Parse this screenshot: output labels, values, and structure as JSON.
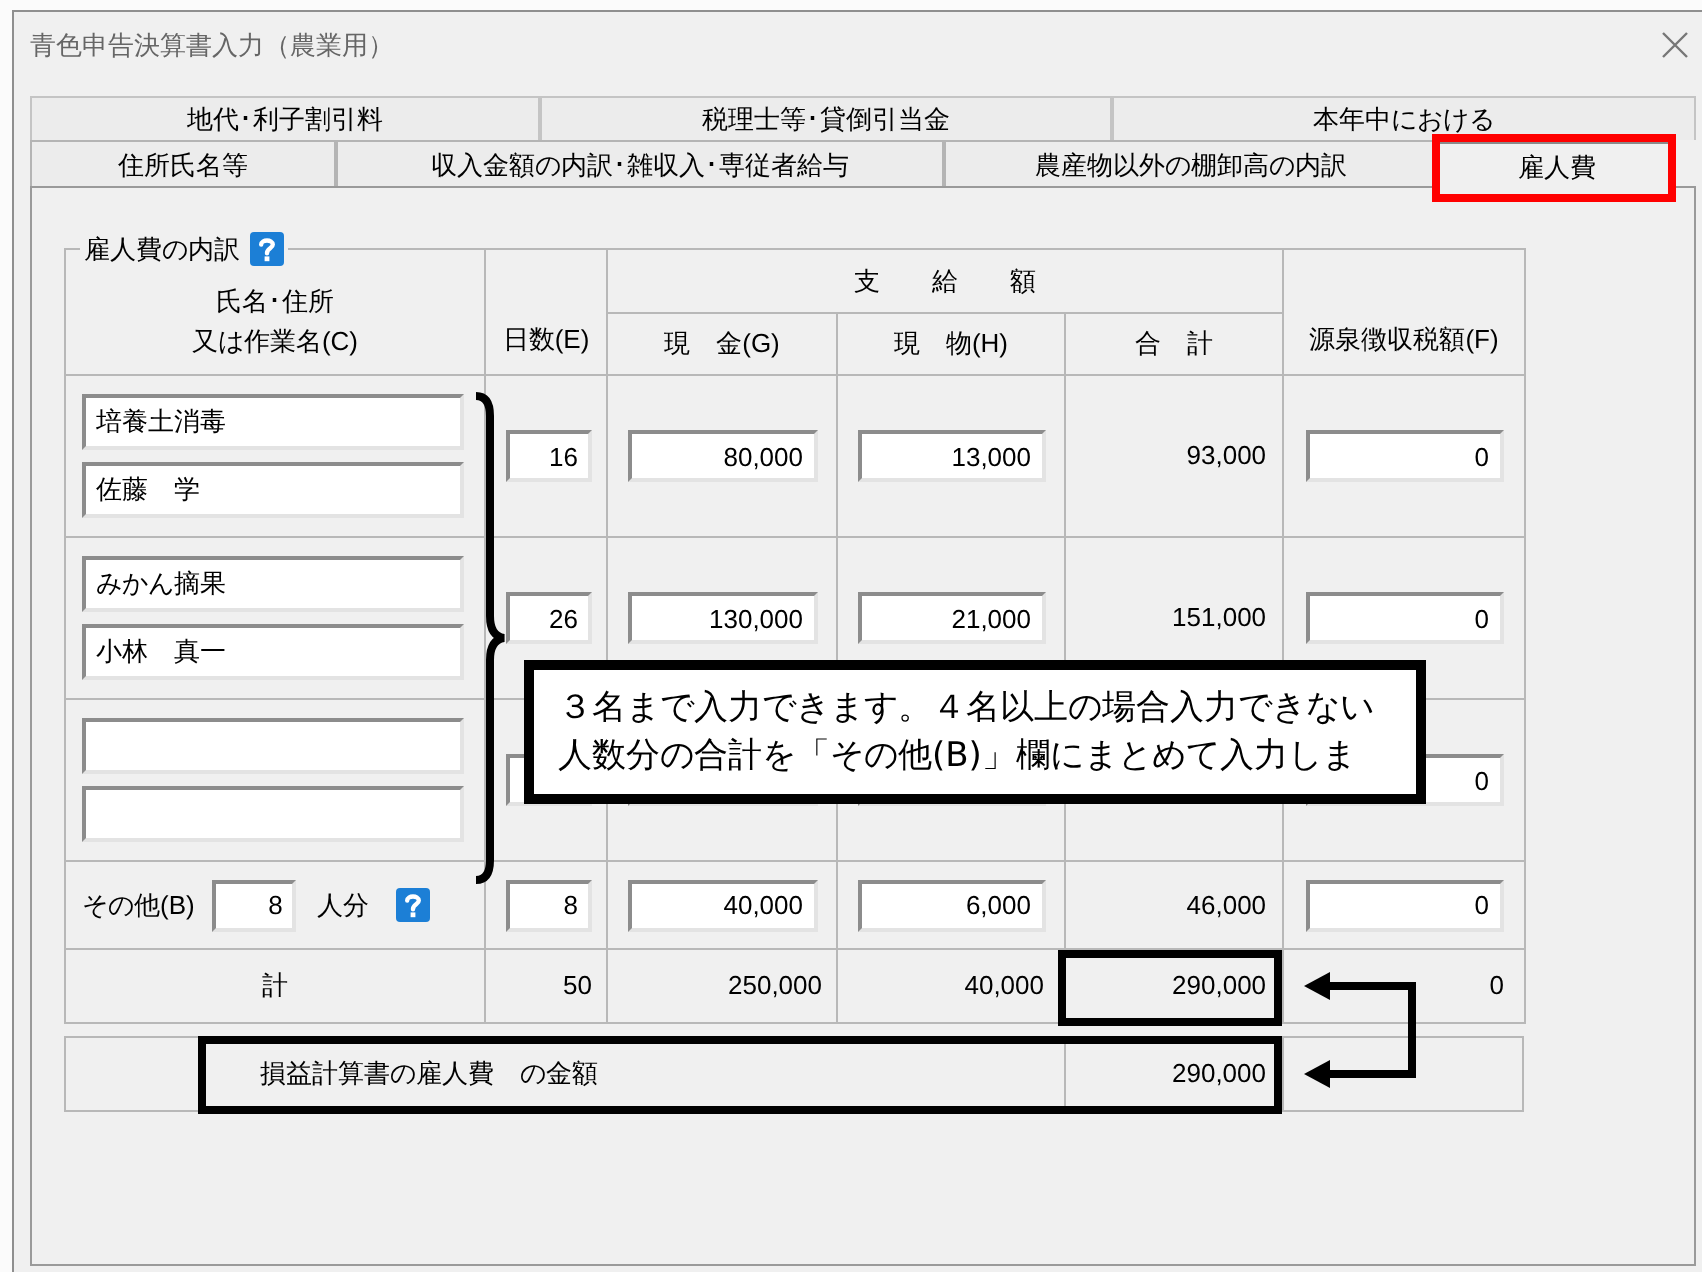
{
  "window": {
    "title": "青色申告決算書入力（農業用）"
  },
  "tabs": {
    "back_row": [
      {
        "label": "地代･利子割引料",
        "selected": false
      },
      {
        "label": "税理士等･貸倒引当金",
        "selected": false
      },
      {
        "label": "本年中における",
        "selected": false
      }
    ],
    "front_row": [
      {
        "label": "住所氏名等",
        "selected": false
      },
      {
        "label": "収入金額の内訳･雑収入･専従者給与",
        "selected": false
      },
      {
        "label": "農産物以外の棚卸高の内訳",
        "selected": false
      },
      {
        "label": "雇人費",
        "selected": true
      }
    ]
  },
  "breakdown": {
    "title": "雇人費の内訳",
    "headers": {
      "name": [
        "氏名･住所",
        "又は作業名(C)"
      ],
      "days": "日数(E)",
      "paid": "支　　給　　額",
      "cash": "現　金(G)",
      "in_kind": "現　物(H)",
      "total": "合　計",
      "withheld": "源泉徴収税額(F)"
    },
    "rows": [
      {
        "kind": "entry",
        "names": [
          "培養土消毒",
          "佐藤　学"
        ],
        "days": "16",
        "cash": "80,000",
        "in_kind": "13,000",
        "total": "93,000",
        "withheld": "0"
      },
      {
        "kind": "entry",
        "names": [
          "みかん摘果",
          "小林　真一"
        ],
        "days": "26",
        "cash": "130,000",
        "in_kind": "21,000",
        "total": "151,000",
        "withheld": "0"
      },
      {
        "kind": "entry",
        "withheld": "0"
      },
      {
        "kind": "other",
        "label": "その他(B)",
        "count": "8",
        "unit": "人分",
        "days": "8",
        "cash": "40,000",
        "in_kind": "6,000",
        "total": "46,000",
        "withheld": "0"
      },
      {
        "kind": "sum",
        "label": "計",
        "days": "50",
        "cash": "250,000",
        "in_kind": "40,000",
        "total": "290,000",
        "withheld": "0"
      }
    ],
    "pl_row": {
      "label": "損益計算書の雇人費　の金額",
      "value": "290,000"
    }
  },
  "callout": {
    "text": "３名まで入力できます。４名以上の場合入力できない人数分の合計を「その他(B)」欄にまとめて入力しま"
  }
}
